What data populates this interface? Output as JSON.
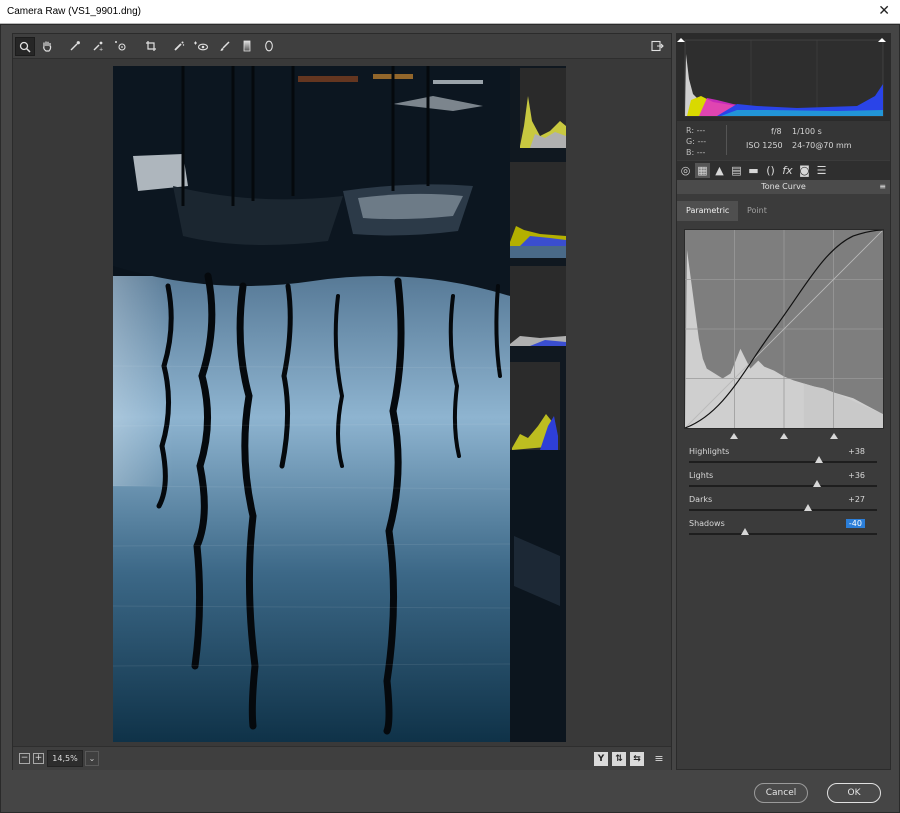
{
  "window": {
    "title": "Camera Raw (VS1_9901.dng)",
    "close_glyph": "✕"
  },
  "toolbar": {
    "tools": [
      {
        "name": "zoom-tool",
        "icon": "magnifier-icon",
        "active": true
      },
      {
        "name": "hand-tool",
        "icon": "hand-icon"
      },
      {
        "name": "white-balance-tool",
        "icon": "eyedropper-icon"
      },
      {
        "name": "color-sampler-tool",
        "icon": "color-sampler-icon"
      },
      {
        "name": "targeted-adjustment-tool",
        "icon": "target-adjust-icon"
      },
      {
        "name": "crop-tool",
        "icon": "crop-icon"
      },
      {
        "name": "spot-removal-tool",
        "icon": "spot-removal-icon"
      },
      {
        "name": "red-eye-tool",
        "icon": "red-eye-icon"
      },
      {
        "name": "adjustment-brush-tool",
        "icon": "brush-icon"
      },
      {
        "name": "graduated-filter-tool",
        "icon": "gradient-icon"
      },
      {
        "name": "radial-filter-tool",
        "icon": "ellipse-icon"
      }
    ],
    "open_preferences_icon": "export-icon"
  },
  "zoom": {
    "minus": "−",
    "plus": "+",
    "level": "14,5%",
    "dropdown_glyph": "⌄"
  },
  "view_buttons": [
    "Y",
    "⇅",
    "⇆",
    "≡"
  ],
  "histogram": {
    "r": "---",
    "g": "---",
    "b": "---",
    "r_label": "R:",
    "g_label": "G:",
    "b_label": "B:",
    "aperture": "f/8",
    "shutter": "1/100 s",
    "iso": "ISO 1250",
    "lens": "24-70@70 mm"
  },
  "panel_tabs": [
    "basic-icon",
    "tone-curve-icon",
    "detail-icon",
    "hsl-icon",
    "split-toning-icon",
    "lens-icon",
    "effects-icon",
    "camera-calibration-icon",
    "presets-icon"
  ],
  "section": {
    "title": "Tone Curve",
    "menu_glyph": "≡"
  },
  "curve_tabs": {
    "parametric": "Parametric",
    "point": "Point"
  },
  "sliders": [
    {
      "label": "Highlights",
      "value": "+38",
      "level": 0.69
    },
    {
      "label": "Lights",
      "value": "+36",
      "level": 0.68
    },
    {
      "label": "Darks",
      "value": "+27",
      "level": 0.635
    },
    {
      "label": "Shadows",
      "value": "-40",
      "level": 0.3,
      "selected": true
    }
  ],
  "buttons": {
    "cancel": "Cancel",
    "ok": "OK"
  },
  "colors": {
    "accent": "#2b7ed8",
    "panel": "#3b3b3b",
    "curve_bg": "#7c7c7c"
  }
}
